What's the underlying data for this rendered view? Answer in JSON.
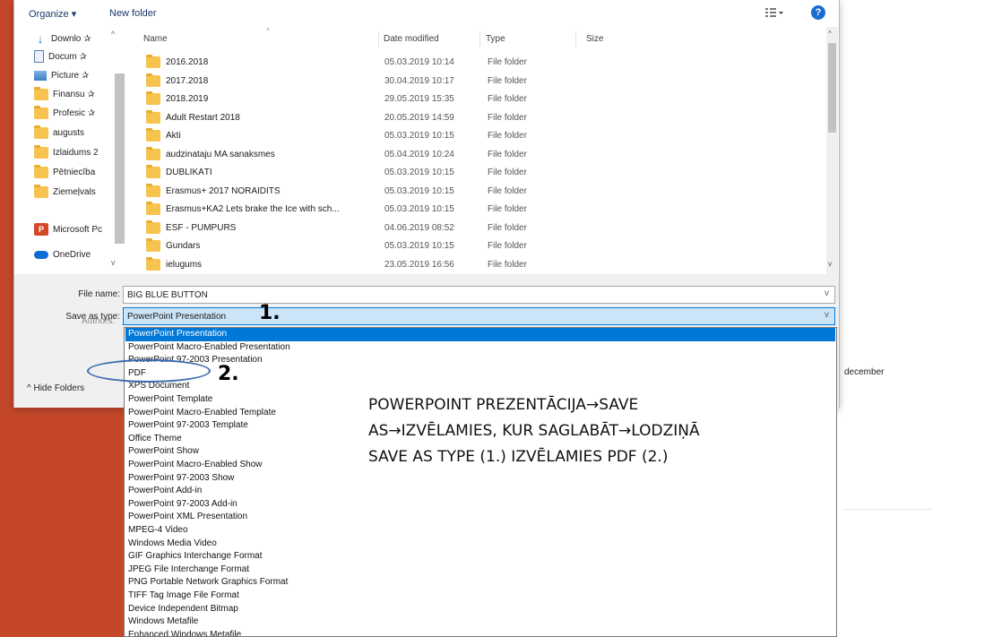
{
  "toolbar": {
    "organize_label": "Organize ▾",
    "new_folder_label": "New folder",
    "view_icon": "view-options-icon",
    "help_glyph": "?"
  },
  "nav": {
    "items": [
      {
        "label": "Downlo ✰",
        "icon": "download-icon"
      },
      {
        "label": "Docum ✰",
        "icon": "document-icon"
      },
      {
        "label": "Picture ✰",
        "icon": "pictures-icon"
      },
      {
        "label": "Finansu ✰",
        "icon": "folder-icon"
      },
      {
        "label": "Profesic ✰",
        "icon": "folder-icon"
      },
      {
        "label": "augusts",
        "icon": "folder-icon"
      },
      {
        "label": "Izlaidums 2",
        "icon": "folder-icon"
      },
      {
        "label": "Pētniecība",
        "icon": "folder-icon"
      },
      {
        "label": "Ziemeļvals",
        "icon": "folder-icon"
      },
      {
        "label": "Microsoft Pc",
        "icon": "powerpoint-icon"
      },
      {
        "label": "OneDrive",
        "icon": "onedrive-icon"
      }
    ]
  },
  "columns": {
    "name": "Name",
    "date": "Date modified",
    "type": "Type",
    "size": "Size"
  },
  "files": [
    {
      "name": "2016.2018",
      "date": "05.03.2019 10:14",
      "type": "File folder"
    },
    {
      "name": "2017.2018",
      "date": "30.04.2019 10:17",
      "type": "File folder"
    },
    {
      "name": "2018.2019",
      "date": "29.05.2019 15:35",
      "type": "File folder"
    },
    {
      "name": "Adult Restart 2018",
      "date": "20.05.2019 14:59",
      "type": "File folder"
    },
    {
      "name": "Akti",
      "date": "05.03.2019 10:15",
      "type": "File folder"
    },
    {
      "name": "audzinataju MA sanaksmes",
      "date": "05.04.2019 10:24",
      "type": "File folder"
    },
    {
      "name": "DUBLIKĀTI",
      "date": "05.03.2019 10:15",
      "type": "File folder"
    },
    {
      "name": "Erasmus+ 2017 NORAIDITS",
      "date": "05.03.2019 10:15",
      "type": "File folder"
    },
    {
      "name": "Erasmus+KA2 Lets brake the Ice with sch...",
      "date": "05.03.2019 10:15",
      "type": "File folder"
    },
    {
      "name": "ESF - PUMPURS",
      "date": "04.06.2019 08:52",
      "type": "File folder"
    },
    {
      "name": "Gundars",
      "date": "05.03.2019 10:15",
      "type": "File folder"
    },
    {
      "name": "ielugums",
      "date": "23.05.2019 16:56",
      "type": "File folder"
    }
  ],
  "form": {
    "file_name_label": "File name:",
    "file_name_value": "BIG BLUE BUTTON",
    "save_type_label": "Save as type:",
    "save_type_value": "PowerPoint Presentation",
    "authors_label": "Authors:",
    "hide_folders_label": "^ Hide Folders"
  },
  "dropdown_options": [
    "PowerPoint Presentation",
    "PowerPoint Macro-Enabled Presentation",
    "PowerPoint 97-2003 Presentation",
    "PDF",
    "XPS Document",
    "PowerPoint Template",
    "PowerPoint Macro-Enabled Template",
    "PowerPoint 97-2003 Template",
    "Office Theme",
    "PowerPoint Show",
    "PowerPoint Macro-Enabled Show",
    "PowerPoint 97-2003 Show",
    "PowerPoint Add-in",
    "PowerPoint 97-2003 Add-in",
    "PowerPoint XML Presentation",
    "MPEG-4 Video",
    "Windows Media Video",
    "GIF Graphics Interchange Format",
    "JPEG File Interchange Format",
    "PNG Portable Network Graphics Format",
    "TIFF Tag Image File Format",
    "Device Independent Bitmap",
    "Windows Metafile",
    "Enhanced Windows Metafile"
  ],
  "background": {
    "side_word": "december"
  },
  "annotations": {
    "step1": "1.",
    "step2": "2.",
    "instruction_lines": [
      "POWERPOINT PREZENTĀCIJA→SAVE",
      "AS→IZVĒLAMIES, KUR SAGLABĀT→LODZIŅĀ",
      "SAVE AS TYPE (1.) IZVĒLAMIES PDF (2.)"
    ]
  },
  "colors": {
    "highlight": "#0078d7",
    "ppt_orange": "#c4472a",
    "folder": "#f6c44e",
    "annotation_ellipse": "#3c6bb0"
  }
}
